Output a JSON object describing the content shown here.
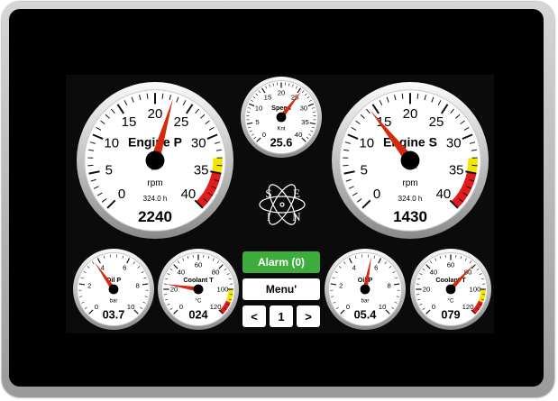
{
  "colors": {
    "background": "#000000",
    "needle": "#d42a0d",
    "alarm_bg": "#3dad3d",
    "hub": "#000000",
    "yellow_zone": "#f2e600",
    "red_zone": "#e21b1b"
  },
  "gauges": [
    {
      "id": "engine-p",
      "label": "Engine P",
      "unit": "rpm",
      "hours": "324.0 h",
      "value": "2240",
      "needle": 22.4,
      "min": 0,
      "max": 40,
      "ticks": [
        "0",
        "5",
        "10",
        "15",
        "20",
        "25",
        "30",
        "35",
        "40"
      ],
      "yellow": [
        33,
        35
      ],
      "red": [
        35,
        40
      ]
    },
    {
      "id": "engine-s",
      "label": "Engine S",
      "unit": "rpm",
      "hours": "324.0 h",
      "value": "1430",
      "needle": 14.3,
      "min": 0,
      "max": 40,
      "ticks": [
        "0",
        "5",
        "10",
        "15",
        "20",
        "25",
        "30",
        "35",
        "40"
      ],
      "yellow": [
        33,
        35
      ],
      "red": [
        35,
        40
      ]
    },
    {
      "id": "speed",
      "label": "Speed",
      "unit": "Knt",
      "hours": "",
      "value": "25.6",
      "needle": 25.6,
      "min": 0,
      "max": 40,
      "ticks": [
        "0",
        "5",
        "10",
        "15",
        "20",
        "25",
        "30",
        "35",
        "40"
      ],
      "yellow": null,
      "red": null
    },
    {
      "id": "oil-p-port",
      "label": "Oil P",
      "unit": "bar",
      "hours": "",
      "value": "03.7",
      "needle": 3.7,
      "min": 0,
      "max": 10,
      "ticks": [
        "0",
        "2",
        "4",
        "6",
        "8",
        "10"
      ],
      "yellow": null,
      "red": null
    },
    {
      "id": "coolant-port",
      "label": "Coolant T",
      "unit": "°C",
      "hours": "",
      "value": "024",
      "needle": 24,
      "min": 0,
      "max": 120,
      "ticks": [
        "0",
        "20",
        "40",
        "60",
        "80",
        "100",
        "120"
      ],
      "yellow": [
        100,
        110
      ],
      "red": [
        110,
        120
      ]
    },
    {
      "id": "oil-p-stbd",
      "label": "Oil P",
      "unit": "bar",
      "hours": "",
      "value": "05.4",
      "needle": 5.4,
      "min": 0,
      "max": 10,
      "ticks": [
        "0",
        "2",
        "4",
        "6",
        "8",
        "10"
      ],
      "yellow": null,
      "red": null
    },
    {
      "id": "coolant-stbd",
      "label": "Coolant T",
      "unit": "°C",
      "hours": "",
      "value": "079",
      "needle": 79,
      "min": 0,
      "max": 120,
      "ticks": [
        "0",
        "20",
        "40",
        "60",
        "80",
        "100",
        "120"
      ],
      "yellow": [
        100,
        110
      ],
      "red": [
        110,
        120
      ]
    }
  ],
  "buttons": {
    "alarm": "Alarm (0)",
    "menu": "Menu'",
    "prev": "<",
    "page": "1",
    "next": ">"
  },
  "logo": {
    "letters": [
      "S",
      "E",
      "I",
      "N"
    ]
  }
}
